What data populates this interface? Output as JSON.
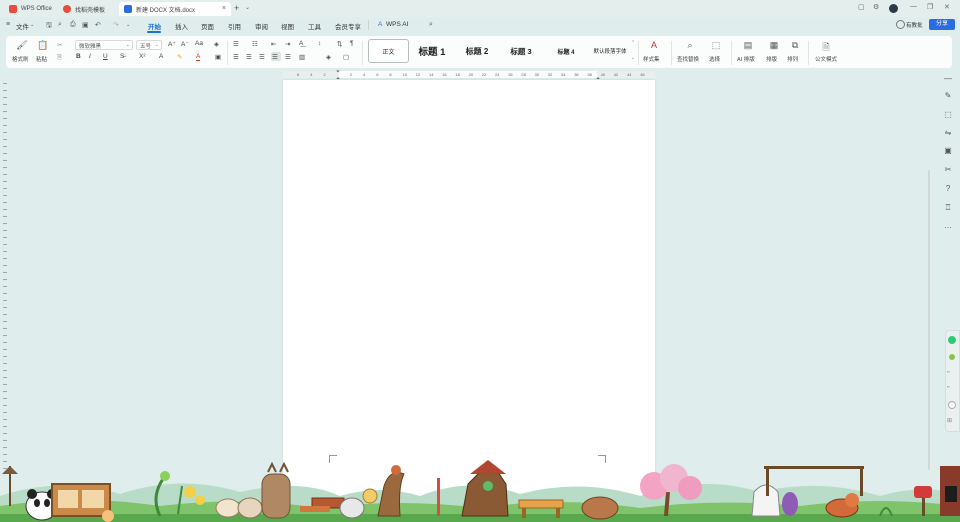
{
  "titlebar": {
    "tabs": [
      {
        "label": "WPS Office",
        "color": "#e74c3c"
      },
      {
        "label": "找稻壳模板",
        "color": "#e74c3c"
      },
      {
        "label": "新建 DOCX 文档.docx",
        "color": "#2b6ce0",
        "active": true
      }
    ],
    "new_tab": "+",
    "tab_list": "⌄"
  },
  "menu": {
    "file": "文件",
    "items": [
      "开始",
      "插入",
      "页面",
      "引用",
      "审阅",
      "视图",
      "工具",
      "会员专享"
    ],
    "active": "开始",
    "wps_ai": "WPS AI",
    "share": "分享",
    "comment": "有教批"
  },
  "ribbon": {
    "format_painter": "格式刷",
    "paste": "粘贴",
    "font_name": "微软雅黑",
    "font_size": "五号",
    "styles": [
      "正文",
      "标题 1",
      "标题 2",
      "标题 3",
      "标题 4",
      "默认段落字体"
    ],
    "style_set": "样式集",
    "find_replace": "查找替换",
    "select": "选择",
    "ai_layout": "AI 排版",
    "layout": "排版",
    "arrange": "排列",
    "official_mode": "公文模式",
    "bold": "B",
    "italic": "I",
    "underline": "U"
  },
  "ruler": {
    "ticks": [
      "6",
      "4",
      "2",
      "",
      "2",
      "4",
      "6",
      "8",
      "10",
      "12",
      "14",
      "16",
      "18",
      "20",
      "22",
      "24",
      "26",
      "28",
      "30",
      "32",
      "34",
      "36",
      "38",
      "40",
      "42",
      "44",
      "46"
    ]
  },
  "colors": {
    "accent": "#1f6fde",
    "background": "#dfeeec",
    "page": "#ffffff"
  },
  "scene": {
    "description_icon": "cartoon-animal-border-decoration"
  }
}
